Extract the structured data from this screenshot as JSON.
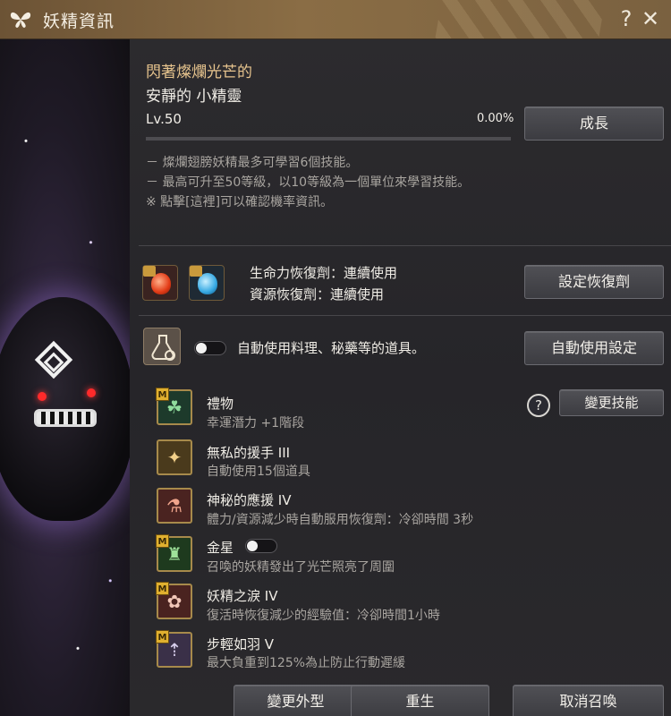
{
  "window": {
    "title": "妖精資訊",
    "help_glyph": "?",
    "close_glyph": "✕"
  },
  "fairy": {
    "line1": "閃著燦爛光芒的",
    "line2": "安靜的 小精靈",
    "level": "Lv.50",
    "progress_text": "0.00%",
    "progress_value": 0.0,
    "grow_button": "成長"
  },
  "info_notes": [
    "－ 燦爛翅膀妖精最多可學習6個技能。",
    "－ 最高可升至50等級，以10等級為一個單位來學習技能。",
    "※ 點擊[這裡]可以確認機率資訊。"
  ],
  "potions": {
    "hp_label": "生命力恢復劑：連續使用",
    "mp_label": "資源恢復劑：連續使用",
    "set_button": "設定恢復劑"
  },
  "auto_use": {
    "label": "自動使用料理、秘藥等的道具。",
    "toggle_on": false,
    "settings_button": "自動使用設定"
  },
  "skills_header": {
    "change_button": "變更技能"
  },
  "skills": [
    {
      "name": "禮物",
      "desc": "幸運潛力 +1階段",
      "badge": "M",
      "icon": "clover-icon",
      "icon_color": "#1d3a2b"
    },
    {
      "name": "無私的援手 III",
      "desc": "自動使用15個道具",
      "badge": "",
      "icon": "fairy-hand-icon",
      "icon_color": "#4a3a1c"
    },
    {
      "name": "神秘的應援 IV",
      "desc": "體力/資源減少時自動服用恢復劑：冷卻時間 3秒",
      "badge": "",
      "icon": "potion-icon",
      "icon_color": "#4a2320"
    },
    {
      "name": "金星",
      "desc": "召喚的妖精發出了光芒照亮了周圍",
      "badge": "M",
      "icon": "lantern-icon",
      "icon_color": "#1e3a1e",
      "toggle_on": false
    },
    {
      "name": "妖精之淚 IV",
      "desc": "復活時恢復減少的經驗值：冷卻時間1小時",
      "badge": "M",
      "icon": "tear-icon",
      "icon_color": "#4a2320"
    },
    {
      "name": "步輕如羽 V",
      "desc": "最大負重到125%為止防止行動遲緩",
      "badge": "M",
      "icon": "weight-icon",
      "icon_color": "#3a3048"
    }
  ],
  "footer": {
    "appearance_button": "變更外型",
    "rebirth_button": "重生",
    "dismiss_button": "取消召喚"
  }
}
